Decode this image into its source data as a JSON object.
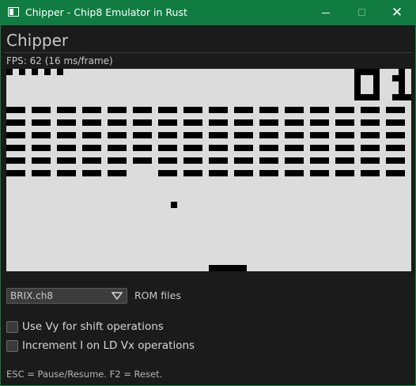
{
  "window": {
    "title": "Chipper - Chip8 Emulator in Rust",
    "titlebar_color": "#107c41"
  },
  "panel": {
    "title": "Chipper",
    "fps_text": "FPS: 62 (16 ms/frame)"
  },
  "display": {
    "resolution": "64x32",
    "background_color": "#dcdcdc",
    "pixel_color": "#000000",
    "score": "01",
    "lives": 5,
    "brick_rows": 6,
    "brick_columns": 16,
    "missing_bricks_last_row": [
      5
    ]
  },
  "rom": {
    "selected": "BRIX.ch8",
    "label": "ROM files"
  },
  "options": [
    {
      "label": "Use Vy for shift operations",
      "checked": false
    },
    {
      "label": "Increment I on  LD Vx operations",
      "checked": false
    }
  ],
  "footer": {
    "hint": "ESC = Pause/Resume.  F2 = Reset."
  }
}
